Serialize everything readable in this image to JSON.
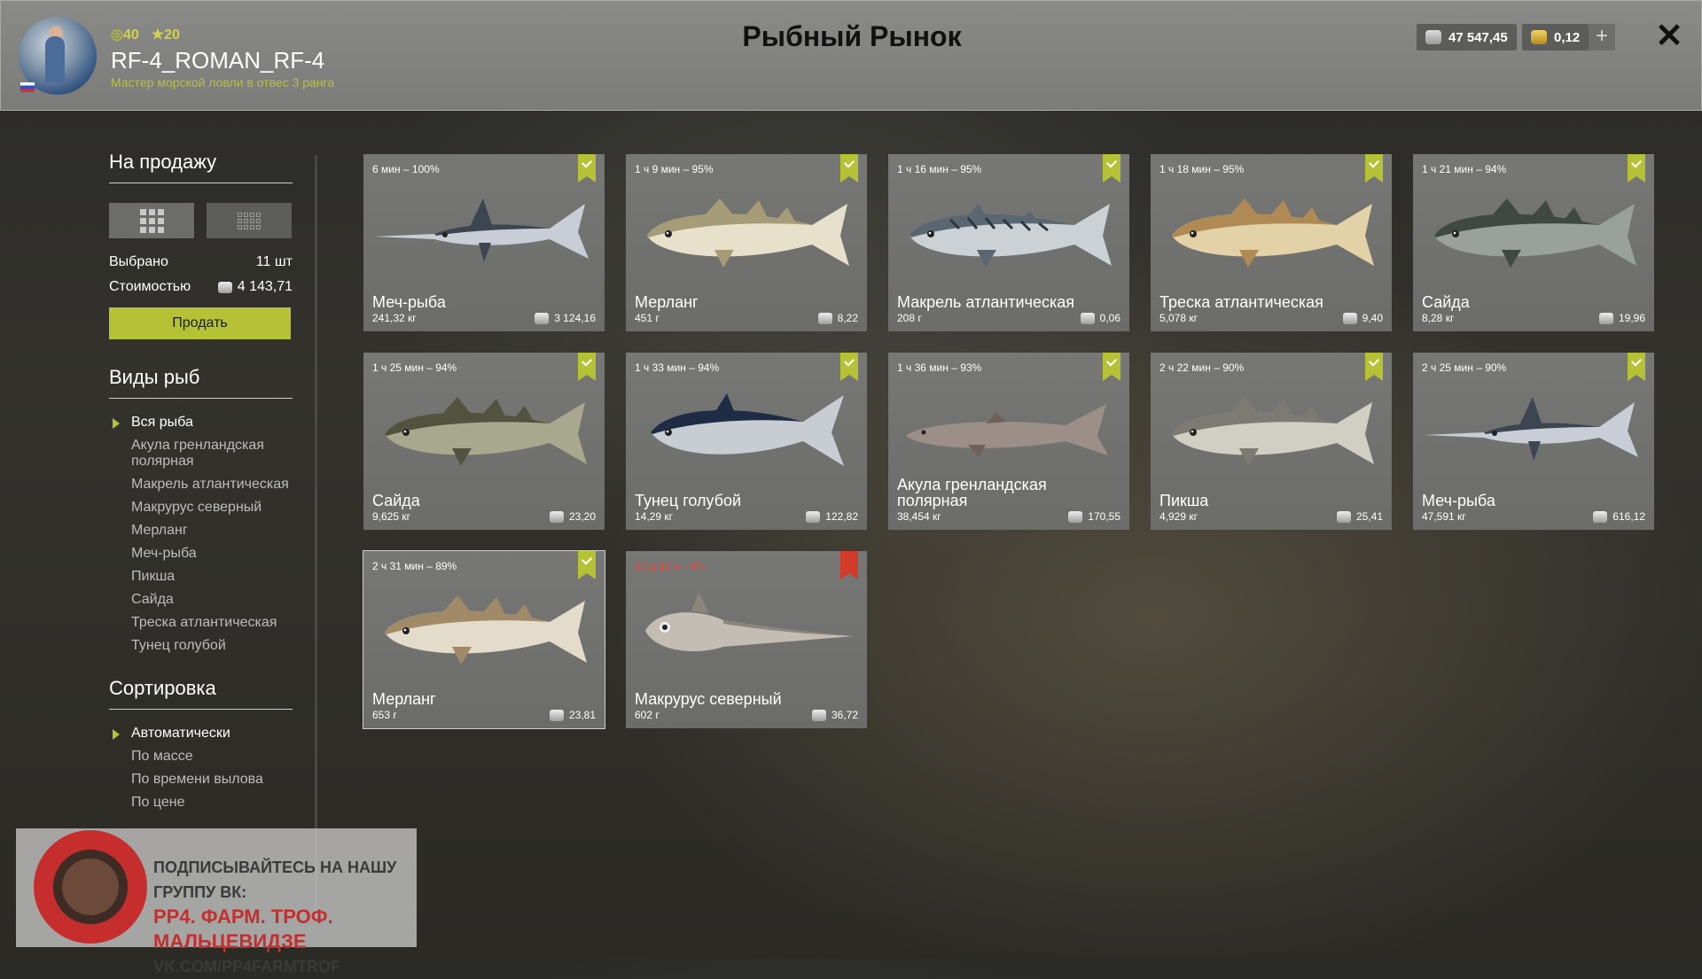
{
  "header": {
    "title": "Рыбный Рынок",
    "level": "40",
    "stars": "20",
    "username": "RF-4_ROMAN_RF-4",
    "rank": "Мастер морской ловли в отвес 3 ранга",
    "silver": "47 547,45",
    "gold": "0,12"
  },
  "sidebar": {
    "for_sale_title": "На продажу",
    "selected_label": "Выбрано",
    "selected_value": "11 шт",
    "cost_label": "Стоимостью",
    "cost_value": "4 143,71",
    "sell_button": "Продать",
    "species_title": "Виды рыб",
    "species": [
      "Вся рыба",
      "Акула гренландская полярная",
      "Макрель атлантическая",
      "Макрурус северный",
      "Мерланг",
      "Меч-рыба",
      "Пикша",
      "Сайда",
      "Треска атлантическая",
      "Тунец голубой"
    ],
    "sort_title": "Сортировка",
    "sort_options": [
      "Автоматически",
      "По массе",
      "По времени вылова",
      "По цене"
    ]
  },
  "cards": [
    {
      "time": "6 мин – 100%",
      "name": "Меч-рыба",
      "weight": "241,32 кг",
      "price": "3 124,16",
      "shape": "swordfish",
      "body": "#c9ced6",
      "back": "#3c4550"
    },
    {
      "time": "1 ч 9 мин – 95%",
      "name": "Мерланг",
      "weight": "451 г",
      "price": "8,22",
      "shape": "whiting",
      "body": "#e7e1cc",
      "back": "#a79c78"
    },
    {
      "time": "1 ч 16 мин – 95%",
      "name": "Макрель атлантическая",
      "weight": "208 г",
      "price": "0,06",
      "shape": "mackerel",
      "body": "#cbd1d4",
      "back": "#5a6670"
    },
    {
      "time": "1 ч 18 мин – 95%",
      "name": "Треска атлантическая",
      "weight": "5,078 кг",
      "price": "9,40",
      "shape": "cod",
      "body": "#e3d1a8",
      "back": "#b08a55"
    },
    {
      "time": "1 ч 21 мин – 94%",
      "name": "Сайда",
      "weight": "8,28 кг",
      "price": "19,96",
      "shape": "saithe",
      "body": "#9aa19a",
      "back": "#3f4843"
    },
    {
      "time": "1 ч 25 мин – 94%",
      "name": "Сайда",
      "weight": "9,625 кг",
      "price": "23,20",
      "shape": "saithe",
      "body": "#a8a88f",
      "back": "#51533f"
    },
    {
      "time": "1 ч 33 мин – 94%",
      "name": "Тунец голубой",
      "weight": "14,29 кг",
      "price": "122,82",
      "shape": "tuna",
      "body": "#c8cdd4",
      "back": "#1f2c45"
    },
    {
      "time": "1 ч 36 мин – 93%",
      "name": "Акула гренландская полярная",
      "weight": "38,454 кг",
      "price": "170,55",
      "shape": "shark",
      "body": "#9b8f87",
      "back": "#6d625b"
    },
    {
      "time": "2 ч 22 мин – 90%",
      "name": "Пикша",
      "weight": "4,929 кг",
      "price": "25,41",
      "shape": "haddock",
      "body": "#d1cec4",
      "back": "#7c7a72"
    },
    {
      "time": "2 ч 25 мин – 90%",
      "name": "Меч-рыба",
      "weight": "47,591 кг",
      "price": "616,12",
      "shape": "swordfish",
      "body": "#c9ced6",
      "back": "#3c4550"
    },
    {
      "time": "2 ч 31 мин – 89%",
      "name": "Мерланг",
      "weight": "653 г",
      "price": "23,81",
      "shape": "whiting",
      "body": "#e4dccb",
      "back": "#a08a68"
    },
    {
      "time": "20 д 13 ч – 0%",
      "name": "Макрурус северный",
      "weight": "602 г",
      "price": "36,72",
      "shape": "grenadier",
      "body": "#c3bdb4",
      "back": "#8c857b",
      "expired": true
    }
  ],
  "watermark": {
    "line1": "ПОДПИСЫВАЙТЕСЬ НА НАШУ ГРУППУ ВК:",
    "line2": "РР4. ФАРМ. ТРОФ. МАЛЬЦЕВИДЗЕ",
    "line3": "VK.COM/PP4FARMTROF"
  }
}
